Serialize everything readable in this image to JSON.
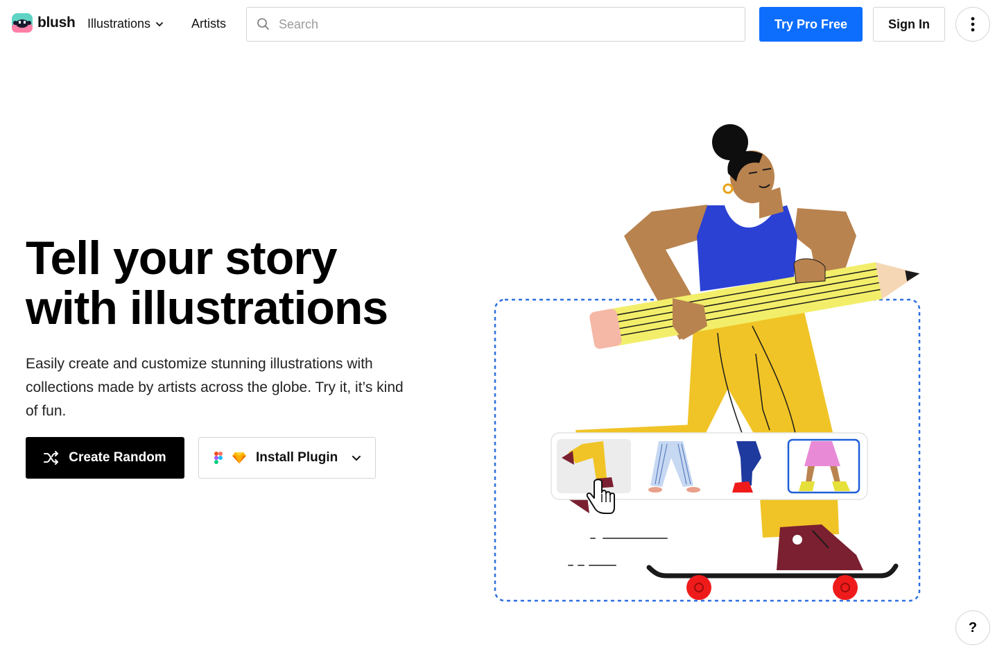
{
  "header": {
    "brand": "blush",
    "nav": {
      "illustrations": "Illustrations",
      "artists": "Artists"
    },
    "search": {
      "placeholder": "Search",
      "value": ""
    },
    "try_pro": "Try Pro Free",
    "sign_in": "Sign In",
    "more_icon": "vertical-dots-icon"
  },
  "hero": {
    "title_line1": "Tell your story",
    "title_line2": "with illustrations",
    "description": "Easily create and customize stunning illustrations with collections made by artists across the globe. Try it, it’s kind of fun.",
    "create_random": "Create Random",
    "install_plugin": "Install Plugin"
  },
  "picker": {
    "options": [
      "yellow-pants-legs",
      "striped-pants-legs",
      "blue-pants-legs",
      "pink-skirt-legs"
    ],
    "hovered_index": 0,
    "selected_index": 3
  },
  "help": {
    "label": "?"
  },
  "colors": {
    "primary": "#0d6efd",
    "black": "#000000",
    "skin": "#b9834f",
    "tank_top": "#2b41d4",
    "pants": "#f0c426",
    "pencil": "#f2ee6a",
    "shoe": "#7a2030",
    "wheel": "#ef1b1b",
    "dashed_border": "#2d6fe0"
  }
}
